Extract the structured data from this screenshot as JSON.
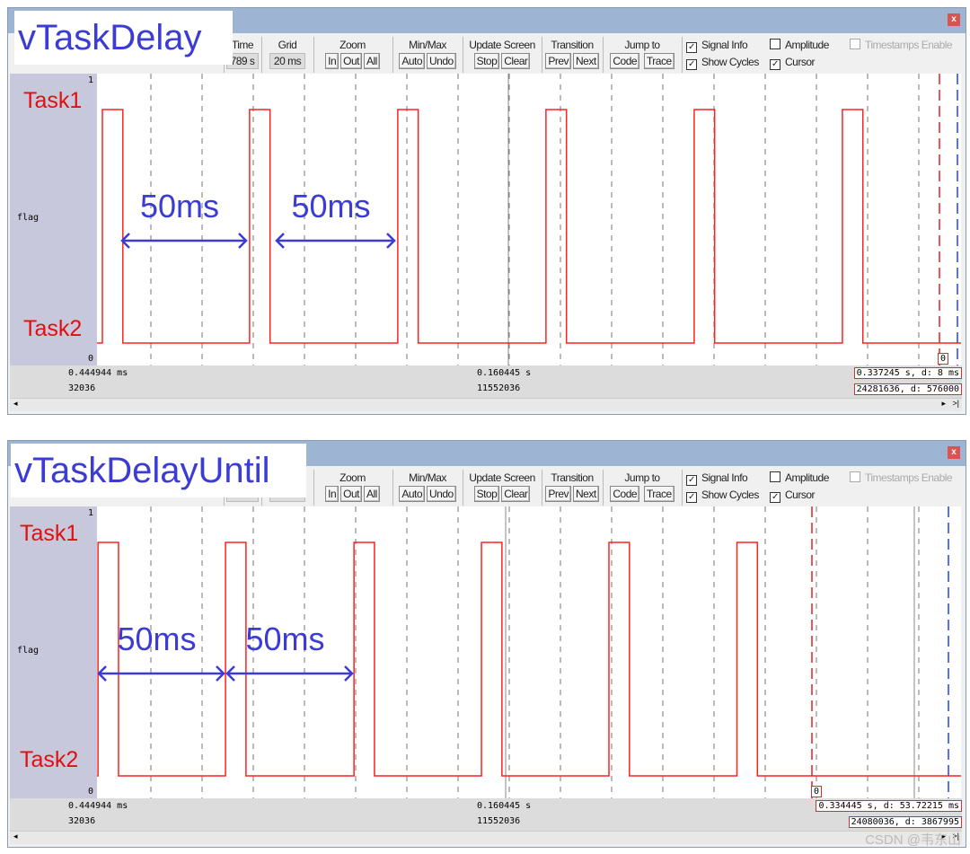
{
  "toolbar": {
    "time_label": "Time",
    "time_value": "789 s",
    "grid_label": "Grid",
    "grid_value": "20 ms",
    "zoom_label": "Zoom",
    "zoom_in": "In",
    "zoom_out": "Out",
    "zoom_all": "All",
    "minmax_label": "Min/Max",
    "auto": "Auto",
    "undo": "Undo",
    "update_label": "Update Screen",
    "stop": "Stop",
    "clear": "Clear",
    "transition_label": "Transition",
    "prev": "Prev",
    "next": "Next",
    "jump_label": "Jump to",
    "code": "Code",
    "trace": "Trace",
    "signal_info": "Signal Info",
    "show_cycles": "Show Cycles",
    "amplitude": "Amplitude",
    "cursor": "Cursor",
    "timestamps": "Timestamps Enable",
    "close": "x"
  },
  "signal": {
    "name": "flag",
    "high": "1",
    "low": "0"
  },
  "panels": [
    {
      "overlay_title": "vTaskDelay",
      "task1": "Task1",
      "task2": "Task2",
      "interval1": "50ms",
      "interval2": "50ms",
      "status": {
        "left_time": "0.444944 ms",
        "left_cycles": "32036",
        "mid_time": "0.160445 s",
        "mid_cycles": "11552036",
        "cursor_time": "0.337245 s,  d: 8 ms",
        "cursor_cycles": "24281636,  d: 576000",
        "marker": "0"
      },
      "pulse_starts_ms": [
        2.1,
        59.6,
        117.5,
        175.4,
        233.3,
        291.2
      ],
      "pulse_width_ms": 8
    },
    {
      "overlay_title": "vTaskDelayUntil",
      "task1": "Task1",
      "task2": "Task2",
      "interval1": "50ms",
      "interval2": "50ms",
      "status": {
        "left_time": "0.444944 ms",
        "left_cycles": "32036",
        "mid_time": "0.160445 s",
        "mid_cycles": "11552036",
        "cursor_time": "0.334445 s,  d: 53.72215 ms",
        "cursor_cycles": "24080036,  d: 3867995",
        "marker": "0"
      },
      "pulse_starts_ms": [
        0.4,
        50.2,
        100.4,
        150.2,
        200,
        250
      ],
      "pulse_width_ms": 8
    }
  ],
  "colors": {
    "wave": "#ff2020",
    "annotation_blue": "#3b3bd6",
    "label_red": "#e01010",
    "titlebar": "#9db5d3"
  },
  "watermark": "CSDN @韦东山"
}
